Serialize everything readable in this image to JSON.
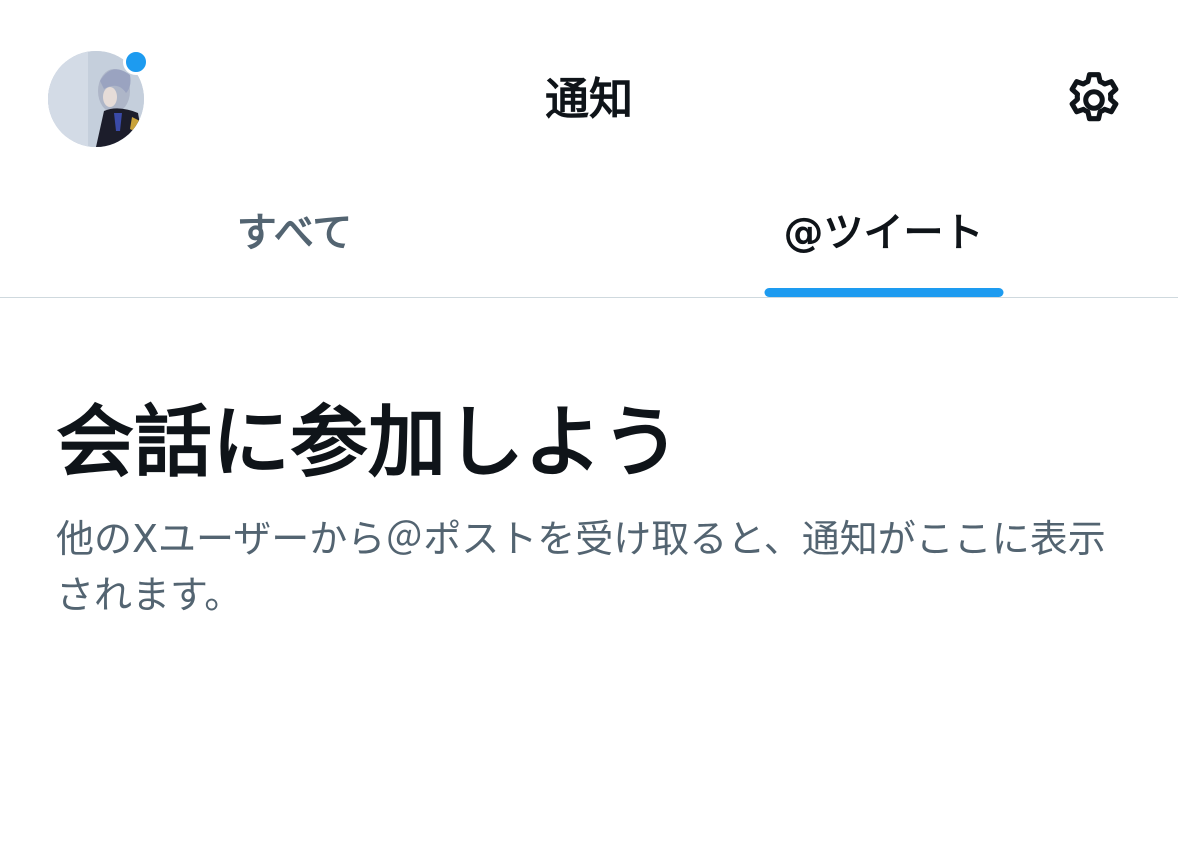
{
  "header": {
    "title": "通知",
    "avatar_icon": "user-avatar",
    "has_unread_dot": true,
    "settings_icon": "gear-icon"
  },
  "tabs": [
    {
      "label": "すべて",
      "selected": false
    },
    {
      "label": "@ツイート",
      "selected": true
    }
  ],
  "empty_state": {
    "headline": "会話に参加しよう",
    "body": "他のXユーザーから＠ポストを受け取ると、通知がここに表示されます。"
  },
  "colors": {
    "accent": "#1d9bf0",
    "text_primary": "#0f1419",
    "text_secondary": "#536471",
    "divider": "#cfd9de"
  }
}
